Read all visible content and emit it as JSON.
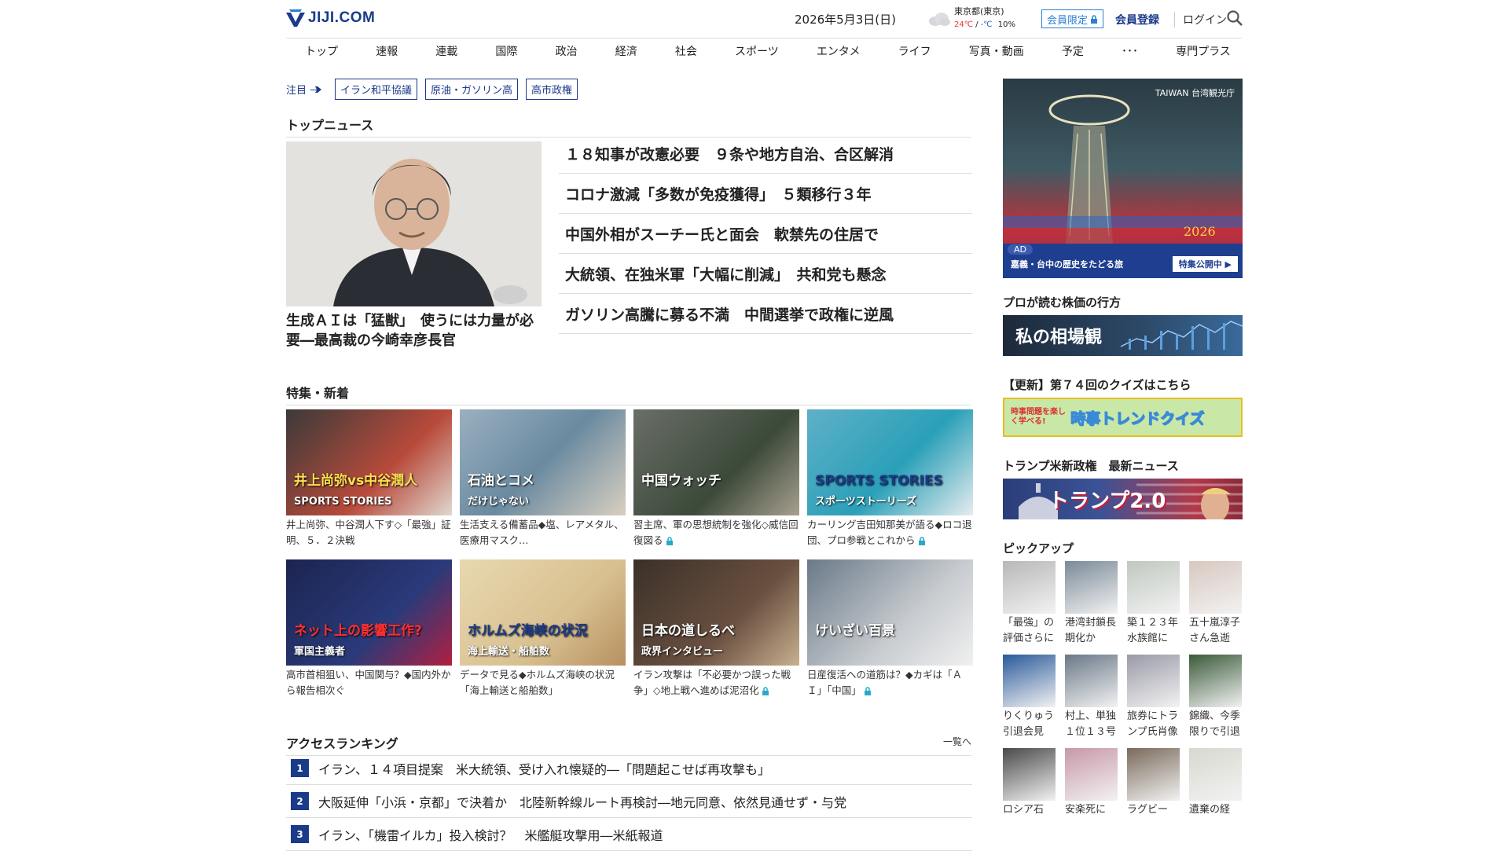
{
  "header": {
    "logo": "JIJI.COM",
    "date": "2026年5月3日(日)",
    "weather": {
      "city": "東京都(東京)",
      "temp_high": "24℃",
      "sep": " / ",
      "temp_low": "-℃",
      "precip": "10%"
    },
    "member_only": "会員限定",
    "member_register": "会員登録",
    "login": "ログイン"
  },
  "nav": [
    "トップ",
    "速報",
    "連載",
    "国際",
    "政治",
    "経済",
    "社会",
    "スポーツ",
    "エンタメ",
    "ライフ",
    "写真・動画",
    "予定",
    "･･･",
    "専門プラス"
  ],
  "attention": {
    "label": "注目",
    "tags": [
      "イラン和平協議",
      "原油・ガソリン高",
      "高市政権"
    ]
  },
  "top_news": {
    "title": "トップニュース",
    "feature_caption": "生成ＡＩは「猛獣」　使うには力量が必要―最高裁の今崎幸彦長官",
    "items": [
      "１８知事が改憲必要　９条や地方自治、合区解消",
      "コロナ激減「多数が免疫獲得」　５類移行３年",
      "中国外相がスーチー氏と面会　軟禁先の住居で",
      "大統領、在独米軍「大幅に削減」　共和党も懸念",
      "ガソリン高騰に募る不満　中間選挙で政権に逆風"
    ]
  },
  "features": {
    "title": "特集・新着",
    "items": [
      {
        "caption": "井上尚弥、中谷潤人下す◇「最強」証明、５．２決戦",
        "locked": false,
        "img_text": "井上尚弥vs中谷潤人",
        "img_sub": "SPORTS STORIES"
      },
      {
        "caption": "生活支える備蓄品◆塩、レアメタル、医療用マスク…",
        "locked": false,
        "img_text": "石油とコメ",
        "img_sub": "だけじゃない"
      },
      {
        "caption": "習主席、軍の思想統制を強化◇威信回復図る",
        "locked": true,
        "img_text": "中国ウォッチ",
        "img_sub": ""
      },
      {
        "caption": "カーリング吉田知那美が語る◆ロコ退団、プロ参戦とこれから",
        "locked": true,
        "img_text": "SPORTS STORIES",
        "img_sub": "スポーツストーリーズ"
      },
      {
        "caption": "高市首相狙い、中国関与？◆国内外から報告相次ぐ",
        "locked": false,
        "img_text": "ネット上の影響工作?",
        "img_sub": "軍国主義者"
      },
      {
        "caption": "データで見る◆ホルムズ海峡の状況「海上輸送と船舶数」",
        "locked": false,
        "img_text": "ホルムズ海峡の状況",
        "img_sub": "海上輸送・船舶数"
      },
      {
        "caption": "イラン攻撃は「不必要かつ誤った戦争」◇地上戦へ進めば泥沼化",
        "locked": true,
        "img_text": "日本の道しるべ",
        "img_sub": "政界インタビュー"
      },
      {
        "caption": "日産復活への道筋は？◆カギは「ＡＩ」「中国」",
        "locked": true,
        "img_text": "けいざい百景",
        "img_sub": ""
      }
    ]
  },
  "ranking": {
    "title": "アクセスランキング",
    "more": "一覧へ",
    "items": [
      {
        "rank": "1",
        "text": "イラン、１４項目提案　米大統領、受け入れ懐疑的―「問題起こせば再攻撃も」"
      },
      {
        "rank": "2",
        "text": "大阪延伸「小浜・京都」で決着か　北陸新幹線ルート再検討―地元同意、依然見通せず・与党"
      },
      {
        "rank": "3",
        "text": "イラン、「機雷イルカ」投入検討？　米艦艇攻撃用―米紙報道"
      }
    ]
  },
  "sidebar": {
    "ad": {
      "brand": "TAIWAN 台湾観光庁",
      "badge": "AD",
      "text": "嘉義・台中の歴史をたどる旅",
      "button": "特集公開中 ▶"
    },
    "stock": {
      "heading": "プロが読む株価の行方",
      "banner": "私の相場観"
    },
    "quiz": {
      "heading": "【更新】第７４回のクイズはこちら",
      "banner_small": "時事問題を楽しく学べる!",
      "banner": "時事トレンドクイズ"
    },
    "trump": {
      "heading": "トランプ米新政権　最新ニュース",
      "banner": "トランプ2.0"
    },
    "pickup": {
      "heading": "ピックアップ",
      "items": [
        "「最強」の評価さらに",
        "港湾封鎖長期化か",
        "築１２３年水族館に",
        "五十嵐淳子さん急逝",
        "りくりゅう引退会見",
        "村上、単独１位１３号",
        "旅券にトランプ氏肖像",
        "錦織、今季限りで引退",
        "ロシア石",
        "安楽死に",
        "ラグビー",
        "遺棄の経"
      ]
    }
  },
  "colors": {
    "brand": "#1a3a8a",
    "accent": "#2b7fd4",
    "rank_bg": "#1a3a8a"
  }
}
